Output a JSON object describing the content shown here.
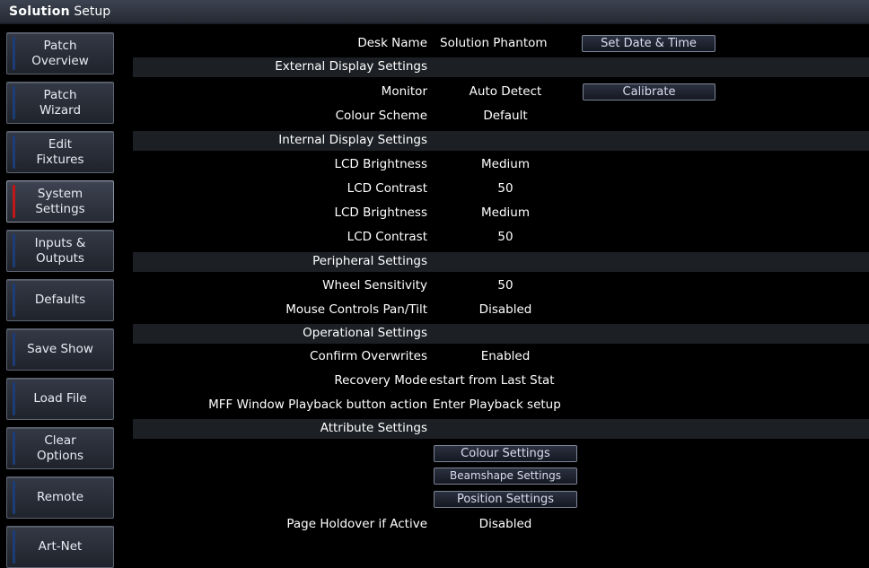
{
  "window": {
    "title_brand": "Solution",
    "title_rest": " Setup"
  },
  "sidebar": {
    "items": [
      {
        "label": "Patch\nOverview"
      },
      {
        "label": "Patch\nWizard"
      },
      {
        "label": "Edit\nFixtures"
      },
      {
        "label": "System\nSettings",
        "active": true
      },
      {
        "label": "Inputs &\nOutputs"
      },
      {
        "label": "Defaults"
      },
      {
        "label": "Save Show"
      },
      {
        "label": "Load File"
      },
      {
        "label": "Clear\nOptions"
      },
      {
        "label": "Remote"
      },
      {
        "label": "Art-Net"
      }
    ]
  },
  "settings": {
    "desk_name": {
      "label": "Desk Name",
      "value": "Solution Phantom",
      "button": "Set Date & Time"
    },
    "external_display_header": "External Display Settings",
    "monitor": {
      "label": "Monitor",
      "value": "Auto Detect",
      "button": "Calibrate"
    },
    "colour_scheme": {
      "label": "Colour Scheme",
      "value": "Default"
    },
    "internal_display_header": "Internal Display Settings",
    "lcd_brightness_1": {
      "label": "LCD Brightness",
      "value": "Medium"
    },
    "lcd_contrast_1": {
      "label": "LCD Contrast",
      "value": "50"
    },
    "lcd_brightness_2": {
      "label": "LCD Brightness",
      "value": "Medium"
    },
    "lcd_contrast_2": {
      "label": "LCD Contrast",
      "value": "50"
    },
    "peripheral_header": "Peripheral Settings",
    "wheel_sensitivity": {
      "label": "Wheel Sensitivity",
      "value": "50"
    },
    "mouse_pan_tilt": {
      "label": "Mouse Controls Pan/Tilt",
      "value": "Disabled"
    },
    "operational_header": "Operational Settings",
    "confirm_overwrites": {
      "label": "Confirm Overwrites",
      "value": "Enabled"
    },
    "recovery_mode": {
      "label": "Recovery Mode",
      "value": "estart from Last Stat"
    },
    "mff_playback": {
      "label": "MFF Window Playback button action",
      "value": "Enter Playback setup"
    },
    "attribute_header": "Attribute Settings",
    "colour_settings_button": "Colour Settings",
    "beamshape_settings_button": "Beamshape Settings",
    "position_settings_button": "Position Settings",
    "page_holdover": {
      "label": "Page Holdover if Active",
      "value": "Disabled"
    }
  },
  "colors": {
    "active_indicator": "#c01818",
    "idle_indicator": "#1c3d78",
    "band": "#1c1f24"
  }
}
